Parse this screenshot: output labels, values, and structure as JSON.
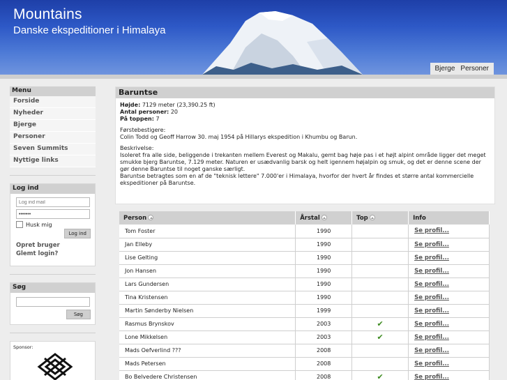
{
  "header": {
    "title": "Mountains",
    "subtitle": "Danske ekspeditioner i Himalaya"
  },
  "topnav": [
    "Bjerge",
    "Personer"
  ],
  "sidebar": {
    "menu_title": "Menu",
    "menu": [
      "Forside",
      "Nyheder",
      "Bjerge",
      "Personer",
      "Seven Summits",
      "Nyttige links"
    ],
    "login_title": "Log ind",
    "login_user_placeholder": "Log ind mail",
    "login_password_value": "•••••••",
    "remember_label": "Husk mig",
    "login_button": "Log ind",
    "create_user": "Opret bruger",
    "forgot_login": "Glemt login?",
    "search_title": "Søg",
    "search_button": "Søg",
    "sponsor_label": "Sponsor:"
  },
  "mountain": {
    "name": "Baruntse",
    "height_label": "Højde:",
    "height_value": "7129 meter (23,390.25 ft)",
    "persons_label": "Antal personer:",
    "persons_value": "20",
    "summit_label": "På toppen:",
    "summit_value": "7",
    "first_label": "Førstebestigere:",
    "first_value": "Colin Todd og Geoff Harrow 30. maj 1954 på Hillarys ekspedition i Khumbu og Barun.",
    "desc_label": "Beskrivelse:",
    "desc_1": "Isoleret fra alle side, beliggende i trekanten mellem Everest og Makalu, gemt bag høje pas i et højt alpint område ligger det meget smukke bjerg Baruntse, 7.129 meter. Naturen er usædvanlig barsk og helt igennem højalpin og smuk, og det er denne scene der gør denne Baruntse til noget ganske særligt.",
    "desc_2": "Baruntse betragtes som en af de \"teknisk lettere\" 7.000'er i Himalaya, hvorfor der hvert år findes et større antal kommercielle ekspeditioner på Baruntse."
  },
  "table": {
    "headers": [
      "Person",
      "Årstal",
      "Top",
      "Info"
    ],
    "link_label": "Se profil...",
    "rows": [
      {
        "name": "Tom Foster",
        "year": "1990",
        "top": false
      },
      {
        "name": "Jan Elleby",
        "year": "1990",
        "top": false
      },
      {
        "name": "Lise Gelting",
        "year": "1990",
        "top": false
      },
      {
        "name": "Jon Hansen",
        "year": "1990",
        "top": false
      },
      {
        "name": "Lars Gundersen",
        "year": "1990",
        "top": false
      },
      {
        "name": "Tina Kristensen",
        "year": "1990",
        "top": false
      },
      {
        "name": "Martin Sønderby Nielsen",
        "year": "1999",
        "top": false
      },
      {
        "name": "Rasmus Brynskov",
        "year": "2003",
        "top": true
      },
      {
        "name": "Lone Mikkelsen",
        "year": "2003",
        "top": true
      },
      {
        "name": "Mads Oefverlind ???",
        "year": "2008",
        "top": false
      },
      {
        "name": "Mads Petersen",
        "year": "2008",
        "top": false
      },
      {
        "name": "Bo Belvedere Christensen",
        "year": "2008",
        "top": true
      }
    ]
  }
}
